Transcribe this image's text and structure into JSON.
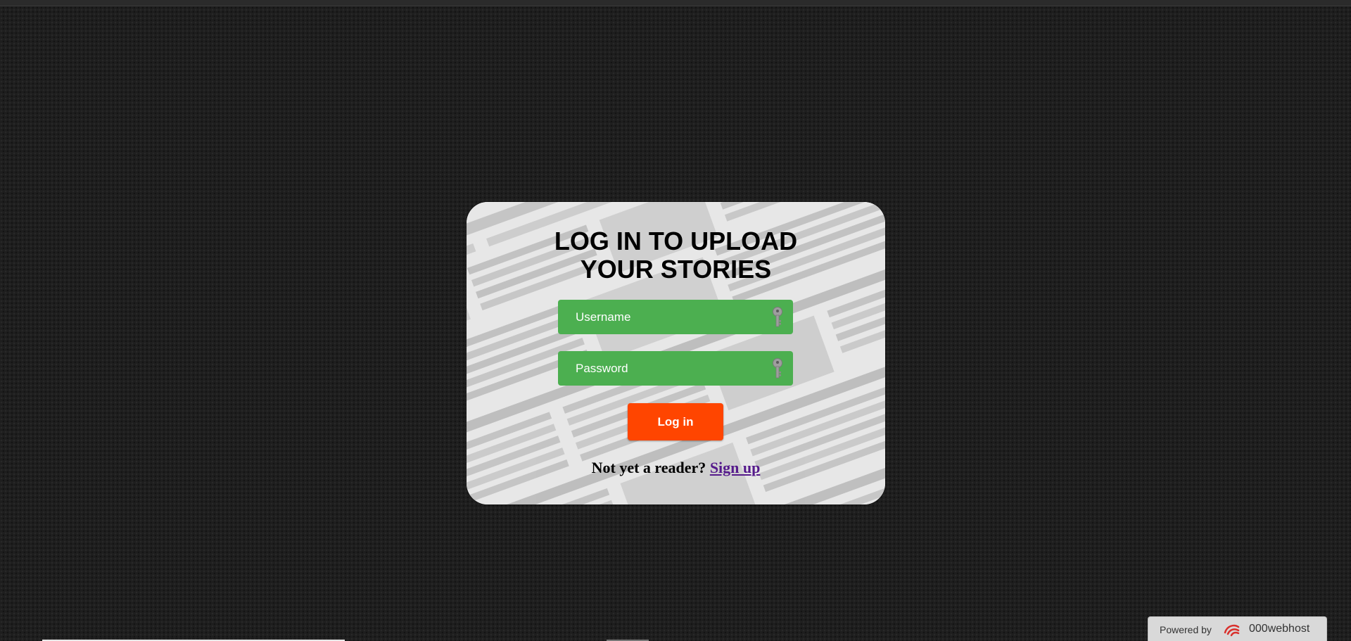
{
  "login": {
    "title_line1": "LOG IN TO UPLOAD",
    "title_line2": "YOUR STORIES",
    "username_placeholder": "Username",
    "password_placeholder": "Password",
    "button_label": "Log in",
    "signup_prompt": "Not yet a reader?",
    "signup_link": "Sign up",
    "field_icon": "key-icon"
  },
  "footer": {
    "powered_by": "Powered by",
    "brand": "000webhost",
    "brand_icon": "000webhost-logo-icon"
  },
  "colors": {
    "page_background": "#1e1e1e",
    "field_background": "#4caf50",
    "button_background": "#ff4500",
    "link": "#551a8b"
  }
}
